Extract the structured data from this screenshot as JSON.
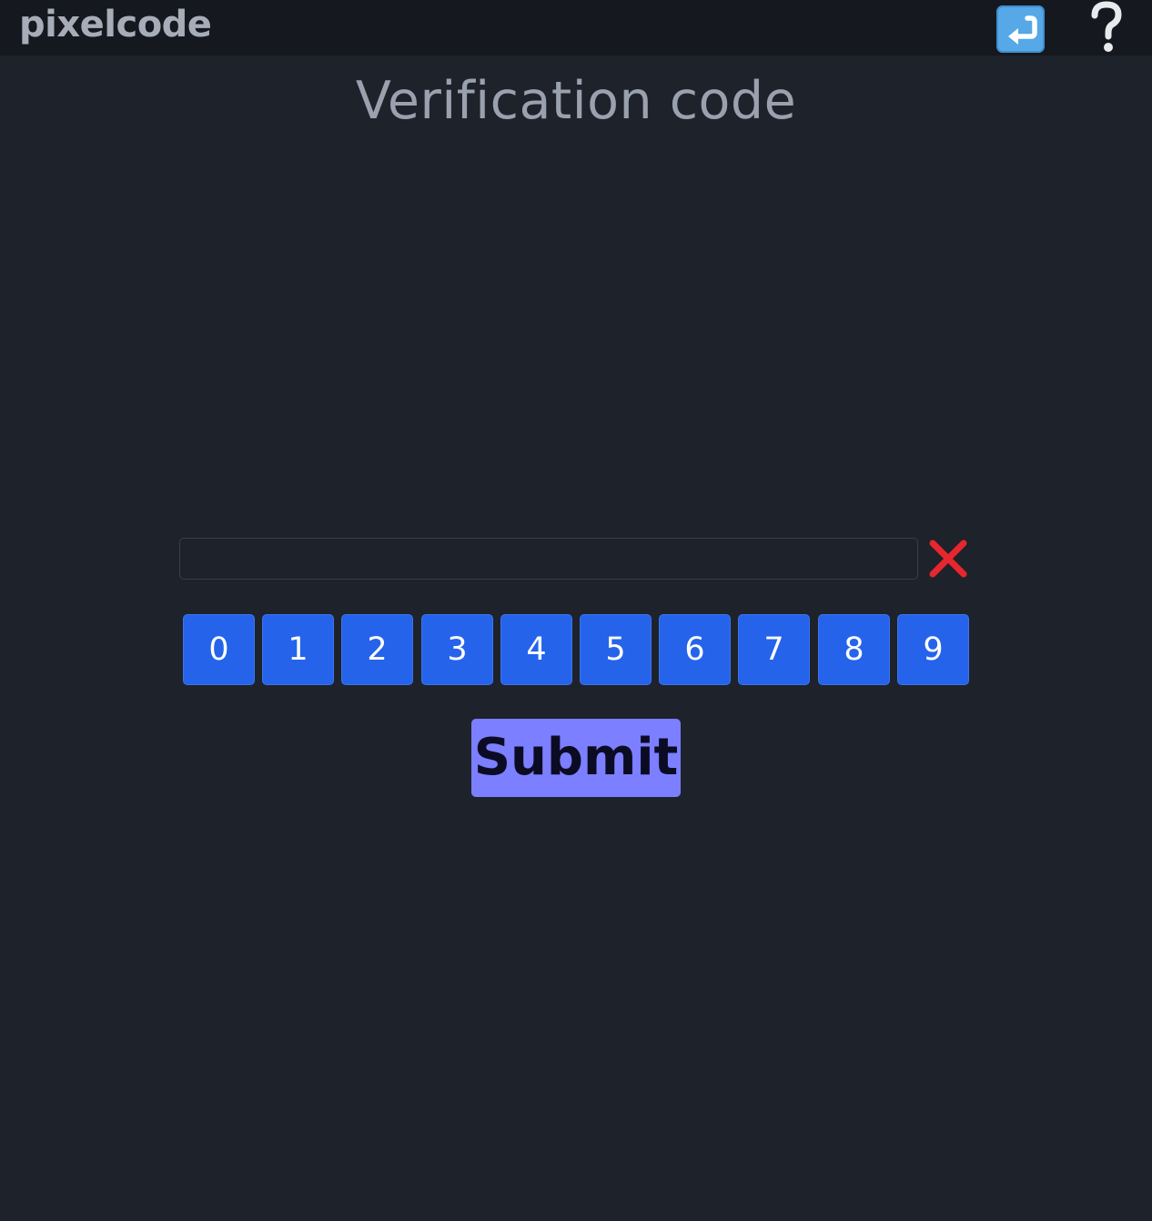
{
  "header": {
    "brand": "pixelcode",
    "return_icon": "return-arrow-icon",
    "help_icon": "question-mark-icon"
  },
  "page": {
    "title": "Verification code"
  },
  "code_field": {
    "value": "",
    "placeholder": "",
    "clear_icon": "cross-mark-icon"
  },
  "keypad": {
    "digits": [
      "0",
      "1",
      "2",
      "3",
      "4",
      "5",
      "6",
      "7",
      "8",
      "9"
    ]
  },
  "actions": {
    "submit_label": "Submit"
  },
  "colors": {
    "background": "#1e222a",
    "header": "#15181e",
    "digit_button": "#2563eb",
    "submit_button": "#7c7fff",
    "clear_mark": "#e8262d"
  }
}
